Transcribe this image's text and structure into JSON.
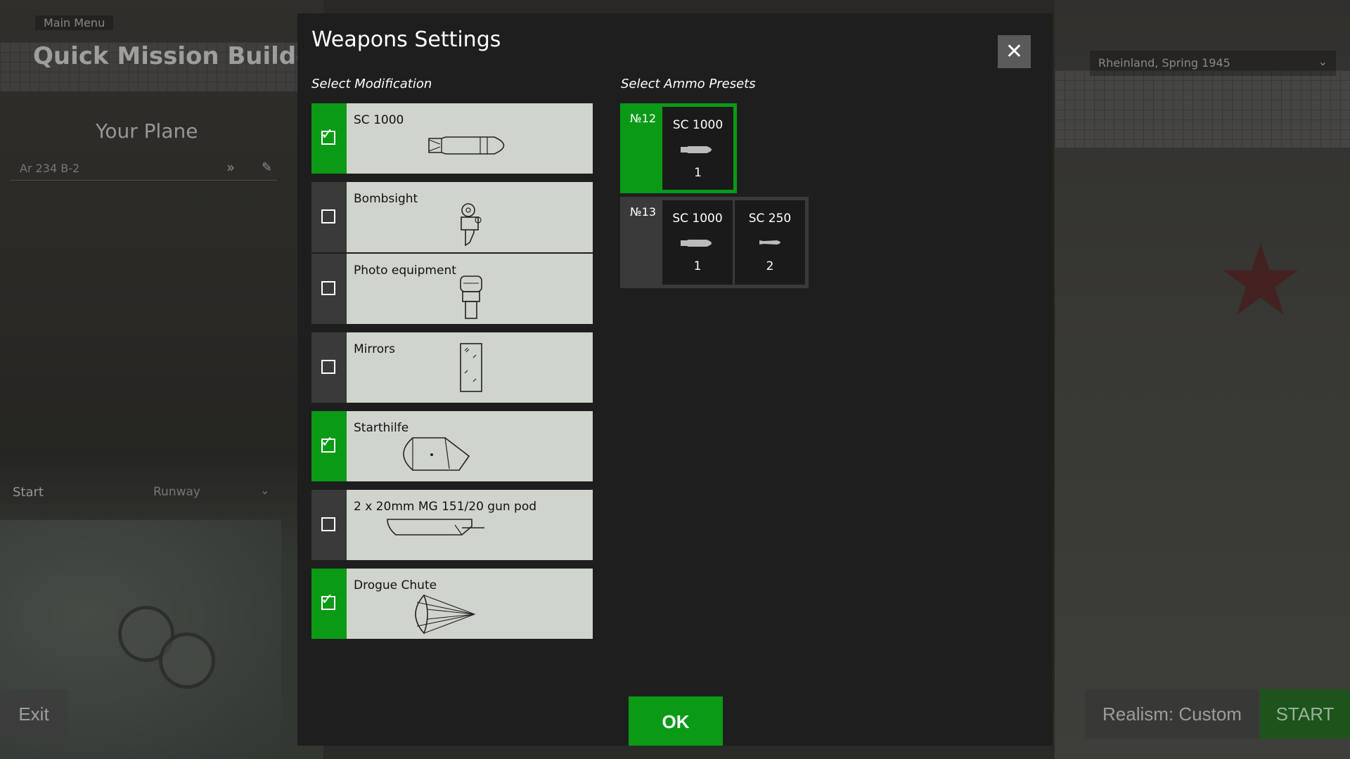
{
  "background": {
    "crumb": "Main Menu",
    "title": "Quick Mission Builder",
    "your_plane": "Your Plane",
    "plane_name": "Ar 234 B-2",
    "start_label": "Start",
    "start_value": "Runway",
    "map_value": "Rheinland, Spring 1945",
    "exit_label": "Exit",
    "realism_label": "Realism: Custom",
    "start_button": "START"
  },
  "dialog": {
    "title": "Weapons Settings",
    "close_glyph": "✕",
    "modification_label": "Select Modification",
    "ammo_label": "Select Ammo Presets",
    "ok_label": "OK",
    "check_glyph": "✓",
    "modifications": [
      {
        "label": "SC 1000",
        "checked": true
      },
      {
        "label": "Bombsight",
        "checked": false
      },
      {
        "label": "Photo equipment",
        "checked": false
      },
      {
        "label": "Mirrors",
        "checked": false
      },
      {
        "label": "Starthilfe",
        "checked": true
      },
      {
        "label": "2 x 20mm MG 151/20 gun pod",
        "checked": false
      },
      {
        "label": "Drogue Chute",
        "checked": true
      }
    ],
    "presets": [
      {
        "number": "№12",
        "selected": true,
        "items": [
          {
            "name": "SC 1000",
            "count": "1"
          }
        ]
      },
      {
        "number": "№13",
        "selected": false,
        "items": [
          {
            "name": "SC 1000",
            "count": "1"
          },
          {
            "name": "SC 250",
            "count": "2"
          }
        ]
      }
    ]
  },
  "colors": {
    "accent_green": "#0a9a16",
    "panel": "#1e1e1e",
    "card": "#cfd5cd"
  }
}
